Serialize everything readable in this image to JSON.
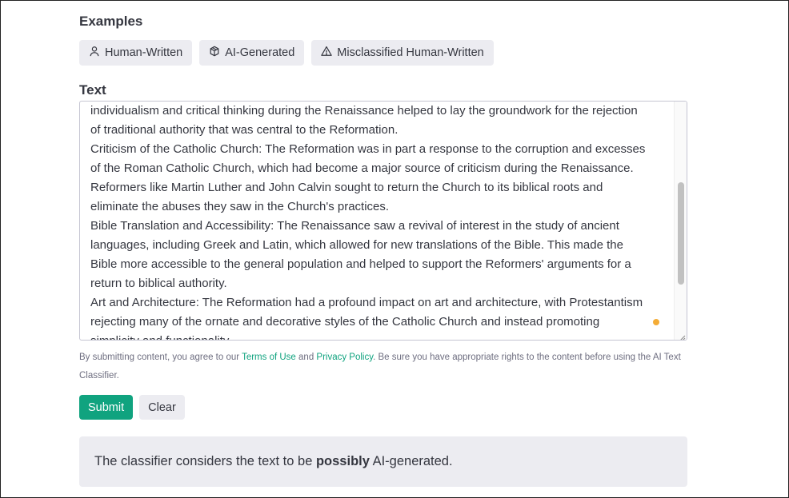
{
  "examples": {
    "title": "Examples",
    "chips": [
      {
        "label": "Human-Written",
        "icon": "person-icon"
      },
      {
        "label": "AI-Generated",
        "icon": "cube-icon"
      },
      {
        "label": "Misclassified Human-Written",
        "icon": "warning-icon"
      }
    ]
  },
  "text": {
    "title": "Text",
    "lines": [
      "individualism and critical thinking during the Renaissance helped to lay the groundwork for the rejection",
      "of traditional authority that was central to the Reformation.",
      "Criticism of the Catholic Church: The Reformation was in part a response to the corruption and excesses",
      "of the Roman Catholic Church, which had become a major source of criticism during the Renaissance.",
      "Reformers like Martin Luther and John Calvin sought to return the Church to its biblical roots and",
      "eliminate the abuses they saw in the Church's practices.",
      "Bible Translation and Accessibility: The Renaissance saw a revival of interest in the study of ancient",
      "languages, including Greek and Latin, which allowed for new translations of the Bible. This made the",
      "Bible more accessible to the general population and helped to support the Reformers' arguments for a",
      "return to biblical authority.",
      "Art and Architecture: The Reformation had a profound impact on art and architecture, with Protestantism",
      "rejecting many of the ornate and decorative styles of the Catholic Church and instead promoting",
      "simplicity and functionality."
    ]
  },
  "disclaimer": {
    "prefix": "By submitting content, you agree to our ",
    "terms_link": "Terms of Use",
    "middle": " and ",
    "privacy_link": "Privacy Policy",
    "suffix": ". Be sure you have appropriate rights to the content before using the AI Text Classifier."
  },
  "buttons": {
    "submit_label": "Submit",
    "clear_label": "Clear"
  },
  "result": {
    "prefix": "The classifier considers the text to be ",
    "emphasis": "possibly",
    "suffix": " AI-generated."
  },
  "colors": {
    "accent": "#10a37f",
    "chip_bg": "#ececf1",
    "status_dot": "#f4ac36"
  }
}
